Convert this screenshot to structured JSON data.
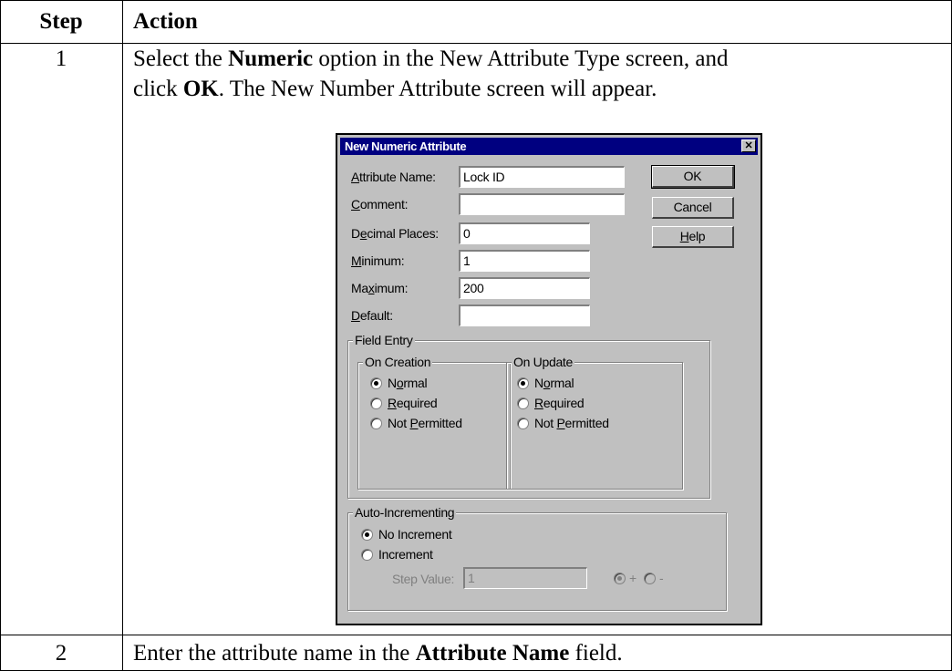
{
  "table": {
    "headers": {
      "step": "Step",
      "action": "Action"
    },
    "rows": [
      {
        "step": "1",
        "line1_a": "Select the ",
        "line1_b": "Numeric",
        "line1_c": " option in the New Attribute Type screen, and",
        "line2_a": "click ",
        "line2_b": "OK",
        "line2_c": ".  The New Number Attribute screen will appear."
      },
      {
        "step": "2",
        "text_a": "Enter the attribute name in the ",
        "text_b": "Attribute Name",
        "text_c": " field."
      }
    ]
  },
  "dialog": {
    "title": "New Numeric Attribute",
    "close_glyph": "✕",
    "fields": {
      "attribute_name": {
        "label_u": "A",
        "label_rest": "ttribute Name:",
        "value": "Lock ID"
      },
      "comment": {
        "label_u": "C",
        "label_rest": "omment:",
        "value": ""
      },
      "decimal_places": {
        "label_pre": "D",
        "label_u": "e",
        "label_rest": "cimal Places:",
        "value": "0"
      },
      "minimum": {
        "label_u": "M",
        "label_rest": "inimum:",
        "value": "1"
      },
      "maximum": {
        "label_pre": "Ma",
        "label_u": "x",
        "label_rest": "imum:",
        "value": "200"
      },
      "default": {
        "label_u": "D",
        "label_rest": "efault:",
        "value": ""
      }
    },
    "buttons": {
      "ok": "OK",
      "cancel": "Cancel",
      "help_u": "H",
      "help_rest": "elp"
    },
    "field_entry": {
      "title": "Field Entry",
      "on_creation": {
        "title": "On Creation",
        "options": [
          {
            "pre": "N",
            "u": "o",
            "rest": "rmal",
            "selected": true
          },
          {
            "pre": "",
            "u": "R",
            "rest": "equired",
            "selected": false
          },
          {
            "pre": "Not ",
            "u": "P",
            "rest": "ermitted",
            "selected": false
          }
        ]
      },
      "on_update": {
        "title": "On Update",
        "options": [
          {
            "pre": "N",
            "u": "o",
            "rest": "rmal",
            "selected": true
          },
          {
            "pre": "",
            "u": "R",
            "rest": "equired",
            "selected": false
          },
          {
            "pre": "Not ",
            "u": "P",
            "rest": "ermitted",
            "selected": false
          }
        ]
      }
    },
    "auto_incrementing": {
      "title": "Auto-Incrementing",
      "no_increment": "No Increment",
      "no_increment_selected": true,
      "increment": "Increment",
      "increment_selected": false,
      "step_value_label": "Step Value:",
      "step_value": "1",
      "plus_label": "+",
      "minus_label": "-",
      "plus_selected": true
    }
  }
}
